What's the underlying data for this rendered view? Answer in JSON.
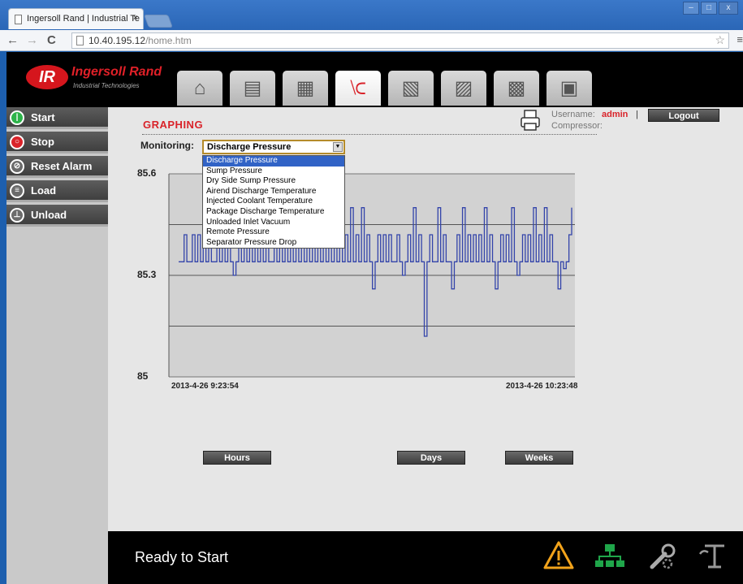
{
  "browser": {
    "tab_title": "Ingersoll Rand | Industrial Te",
    "tab_close": "×",
    "url_host": "10.40.195.12",
    "url_path": "/home.htm",
    "back": "←",
    "forward": "→",
    "reload": "C",
    "star": "☆",
    "menu": "≡",
    "win_min": "–",
    "win_max": "□",
    "win_close": "x"
  },
  "brand": {
    "logo_mark": "IR",
    "name": "Ingersoll Rand",
    "subtitle": "Industrial Technologies",
    "color": "#e02028"
  },
  "nav_tabs": [
    {
      "icon": "home-icon",
      "glyph": "⌂",
      "active": false
    },
    {
      "icon": "status-icon",
      "glyph": "▤",
      "active": false
    },
    {
      "icon": "sequencer-icon",
      "glyph": "▦",
      "active": false
    },
    {
      "icon": "graph-icon",
      "glyph": "⟈",
      "active": true
    },
    {
      "icon": "settings-icon",
      "glyph": "▧",
      "active": false
    },
    {
      "icon": "log-icon",
      "glyph": "▨",
      "active": false
    },
    {
      "icon": "maintenance-icon",
      "glyph": "▩",
      "active": false
    },
    {
      "icon": "id-card-icon",
      "glyph": "▣",
      "active": false
    }
  ],
  "sidebar": {
    "items": [
      {
        "label": "Start",
        "icon": "power-icon",
        "glyph": "|",
        "icon_color": "#2db34a"
      },
      {
        "label": "Stop",
        "icon": "stop-icon",
        "glyph": "○",
        "icon_color": "#d9232a"
      },
      {
        "label": "Reset Alarm",
        "icon": "reset-alarm-icon",
        "glyph": "⊘",
        "icon_color": "#6b6b6b"
      },
      {
        "label": "Load",
        "icon": "load-icon",
        "glyph": "≡",
        "icon_color": "#6b6b6b"
      },
      {
        "label": "Unload",
        "icon": "unload-icon",
        "glyph": "⊥",
        "icon_color": "#6b6b6b"
      }
    ]
  },
  "page": {
    "title": "GRAPHING",
    "username_label": "Username:",
    "username": "admin",
    "separator": "|",
    "compressor_label": "Compressor:",
    "logout_label": "Logout"
  },
  "monitoring": {
    "label": "Monitoring:",
    "selected": "Discharge Pressure",
    "options": [
      "Discharge Pressure",
      "Sump Pressure",
      "Dry Side Sump Pressure",
      "Airend Discharge Temperature",
      "Injected Coolant Temperature",
      "Package Discharge Temperature",
      "Unloaded Inlet Vacuum",
      "Remote Pressure",
      "Separator Pressure Drop"
    ]
  },
  "chart_data": {
    "type": "line",
    "x_start": "2013-4-26 9:23:54",
    "x_end": "2013-4-26 10:23:48",
    "ytick_labels": [
      "85.6",
      "85.3",
      "85"
    ],
    "ylim": [
      85,
      85.6
    ],
    "grid": true,
    "series": [
      {
        "color": "#3344aa",
        "values": [
          85.34,
          85.34,
          85.42,
          85.34,
          85.34,
          85.42,
          85.34,
          85.42,
          85.34,
          85.42,
          85.34,
          85.42,
          85.34,
          85.34,
          85.42,
          85.34,
          85.42,
          85.34,
          85.42,
          85.34,
          85.3,
          85.34,
          85.42,
          85.34,
          85.42,
          85.34,
          85.42,
          85.34,
          85.42,
          85.34,
          85.42,
          85.34,
          85.42,
          85.34,
          85.34,
          85.42,
          85.34,
          85.42,
          85.34,
          85.42,
          85.34,
          85.42,
          85.34,
          85.42,
          85.34,
          85.42,
          85.34,
          85.5,
          85.34,
          85.42,
          85.34,
          85.42,
          85.34,
          85.42,
          85.34,
          85.42,
          85.34,
          85.42,
          85.34,
          85.5,
          85.34,
          85.42,
          85.34,
          85.5,
          85.34,
          85.42,
          85.34,
          85.5,
          85.34,
          85.42,
          85.34,
          85.26,
          85.34,
          85.42,
          85.34,
          85.42,
          85.34,
          85.42,
          85.34,
          85.34,
          85.42,
          85.34,
          85.3,
          85.34,
          85.42,
          85.34,
          85.5,
          85.34,
          85.42,
          85.34,
          85.12,
          85.34,
          85.42,
          85.34,
          85.34,
          85.5,
          85.34,
          85.42,
          85.34,
          85.34,
          85.26,
          85.34,
          85.42,
          85.34,
          85.5,
          85.34,
          85.42,
          85.34,
          85.42,
          85.34,
          85.42,
          85.34,
          85.5,
          85.34,
          85.42,
          85.34,
          85.26,
          85.34,
          85.42,
          85.34,
          85.42,
          85.34,
          85.5,
          85.34,
          85.3,
          85.34,
          85.42,
          85.34,
          85.42,
          85.34,
          85.5,
          85.34,
          85.42,
          85.34,
          85.5,
          85.34,
          85.42,
          85.34,
          85.34,
          85.26,
          85.34,
          85.32,
          85.34,
          85.42,
          85.5
        ]
      }
    ]
  },
  "range_buttons": {
    "hours": "Hours",
    "days": "Days",
    "weeks": "Weeks"
  },
  "footer": {
    "status": "Ready to Start",
    "icons": [
      "warning-icon",
      "network-icon",
      "service-icon",
      "unload-status-icon"
    ]
  }
}
